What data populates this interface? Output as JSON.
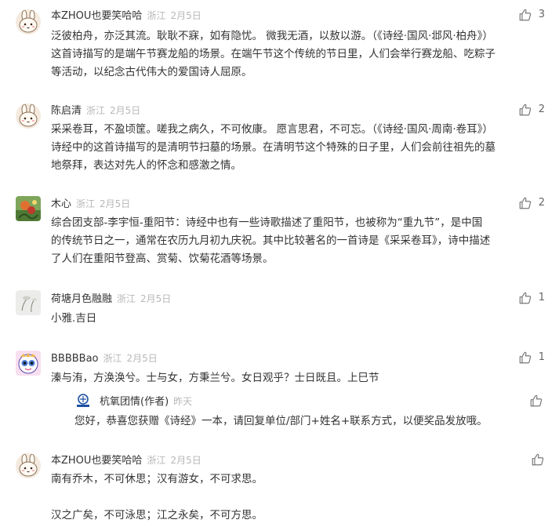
{
  "comments": [
    {
      "author": "本ZHOU也要笑哈哈",
      "location": "浙江",
      "date": "2月5日",
      "likes": "3",
      "avatar": "bunny-avatar",
      "lines": [
        "泛彼柏舟，亦泛其流。耿耿不寐，如有隐忧。 微我无酒，以敖以游。（《诗经·国风·邶风·柏舟》）",
        "这首诗描写的是端午节赛龙船的场景。在端午节这个传统的节日里，人们会举行赛龙船、吃粽子",
        "等活动，以纪念古代伟大的爱国诗人屈原。"
      ]
    },
    {
      "author": "陈启清",
      "location": "浙江",
      "date": "2月5日",
      "likes": "2",
      "avatar": "bunny-avatar",
      "lines": [
        "采采卷耳，不盈顷筐。嗟我之病久，不可攸康。 愿言思君，不可忘。（《诗经·国风·周南·卷耳》）",
        "诗经中的这首诗描写的是清明节扫墓的场景。在清明节这个特殊的日子里，人们会前往祖先的墓",
        "地祭拜，表达对先人的怀念和感激之情。"
      ]
    },
    {
      "author": "木心",
      "location": "浙江",
      "date": "2月5日",
      "likes": "2",
      "avatar": "painting-avatar",
      "lines": [
        "综合团支部-李宇恒-重阳节：诗经中也有一些诗歌描述了重阳节，也被称为“重九节”，是中国",
        "的传统节日之一，通常在农历九月初九庆祝。其中比较著名的一首诗是《采采卷耳》，诗中描述",
        "了人们在重阳节登高、赏菊、饮菊花酒等场景。"
      ]
    },
    {
      "author": "荷塘月色融融",
      "location": "浙江",
      "date": "2月5日",
      "likes": "1",
      "avatar": "lotus-avatar",
      "lines": [
        "小雅.吉日"
      ]
    },
    {
      "author": "BBBBBao",
      "location": "浙江",
      "date": "2月5日",
      "likes": "1",
      "avatar": "cartoon-face-avatar",
      "lines": [
        "溱与洧，方涣涣兮。士与女，方秉兰兮。女日观乎？士日既且。上巳节"
      ],
      "reply": {
        "author": "杭氧团情(作者)",
        "date": "昨天",
        "avatar": "logo-avatar",
        "lines": [
          "您好，恭喜您获赠《诗经》一本，请回复单位/部门+姓名+联系方式，以便奖品发放哦。"
        ]
      }
    },
    {
      "author": "本ZHOU也要笑哈哈",
      "location": "浙江",
      "date": "2月5日",
      "likes": "",
      "avatar": "bunny-avatar",
      "lines": [
        "南有乔木，不可休思；汉有游女，不可求思。",
        "",
        "汉之广矣，不可泳思；江之永矣，不可方思。"
      ]
    }
  ],
  "icons": {
    "like": "thumbs-up-icon"
  },
  "colors": {
    "text": "#333333",
    "meta": "#b7b7b7",
    "like": "#666666"
  }
}
